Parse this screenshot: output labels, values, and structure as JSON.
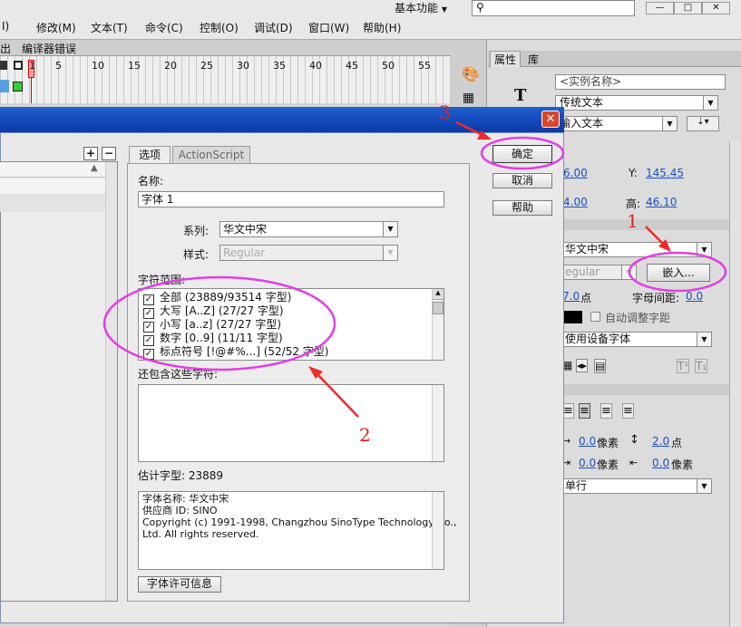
{
  "menu": {
    "items": [
      "I)",
      "修改(M)",
      "文本(T)",
      "命令(C)",
      "控制(O)",
      "调试(D)",
      "窗口(W)",
      "帮助(H)"
    ],
    "workspace": "基本功能"
  },
  "timeline": {
    "tabs": [
      "出",
      "编译器错误"
    ],
    "frame_numbers": [
      "1",
      "5",
      "10",
      "15",
      "20",
      "25",
      "30",
      "35",
      "40",
      "45",
      "50",
      "55"
    ]
  },
  "props": {
    "tabs": [
      "属性",
      "库"
    ],
    "instance_placeholder": "<实例名称>",
    "text_engine": "传统文本",
    "text_type": "输入文本",
    "x_value": "6.00",
    "y_label": "Y:",
    "y_value": "145.45",
    "w_value": "4.00",
    "h_label": "高:",
    "h_value": "46.10",
    "font_family": "华文中宋",
    "font_style": "egular",
    "embed_button": "嵌入...",
    "size_value": "7.0",
    "size_unit": "点",
    "letter_spacing_label": "字母间距:",
    "letter_spacing_value": "0.0",
    "auto_kern": "自动调整字距",
    "render": "使用设备字体",
    "indent_value": "0.0",
    "indent_unit": "像素",
    "line_spacing_value": "2.0",
    "line_spacing_unit": "点",
    "left_margin_value": "0.0",
    "left_margin_unit": "像素",
    "right_margin_value": "0.0",
    "right_margin_unit": "像素",
    "line_type": "单行"
  },
  "dialog": {
    "tabs": [
      "选项",
      "ActionScript"
    ],
    "name_label": "名称:",
    "name_value": "字体 1",
    "family_label": "系列:",
    "family_value": "华文中宋",
    "style_label": "样式:",
    "style_value": "Regular",
    "ranges_label": "字符范围:",
    "ranges": [
      "全部 (23889/93514 字型)",
      "大写 [A..Z] (27/27 字型)",
      "小写 [a..z] (27/27 字型)",
      "数字 [0..9] (11/11 字型)",
      "标点符号 [!@#%...] (52/52 字型)"
    ],
    "also_include_label": "还包含这些字符:",
    "estimate_label": "估计字型: 23889",
    "font_info": [
      "字体名称: 华文中宋",
      "供应商 ID: SINO",
      "Copyright (c) 1991-1998, Changzhou SinoType Technology Co.,",
      "Ltd.  All rights reserved."
    ],
    "license_button": "字体许可信息",
    "ok_button": "确定",
    "cancel_button": "取消",
    "help_button": "帮助"
  },
  "annotations": {
    "a1": "1",
    "a2": "2",
    "a3": "3"
  }
}
